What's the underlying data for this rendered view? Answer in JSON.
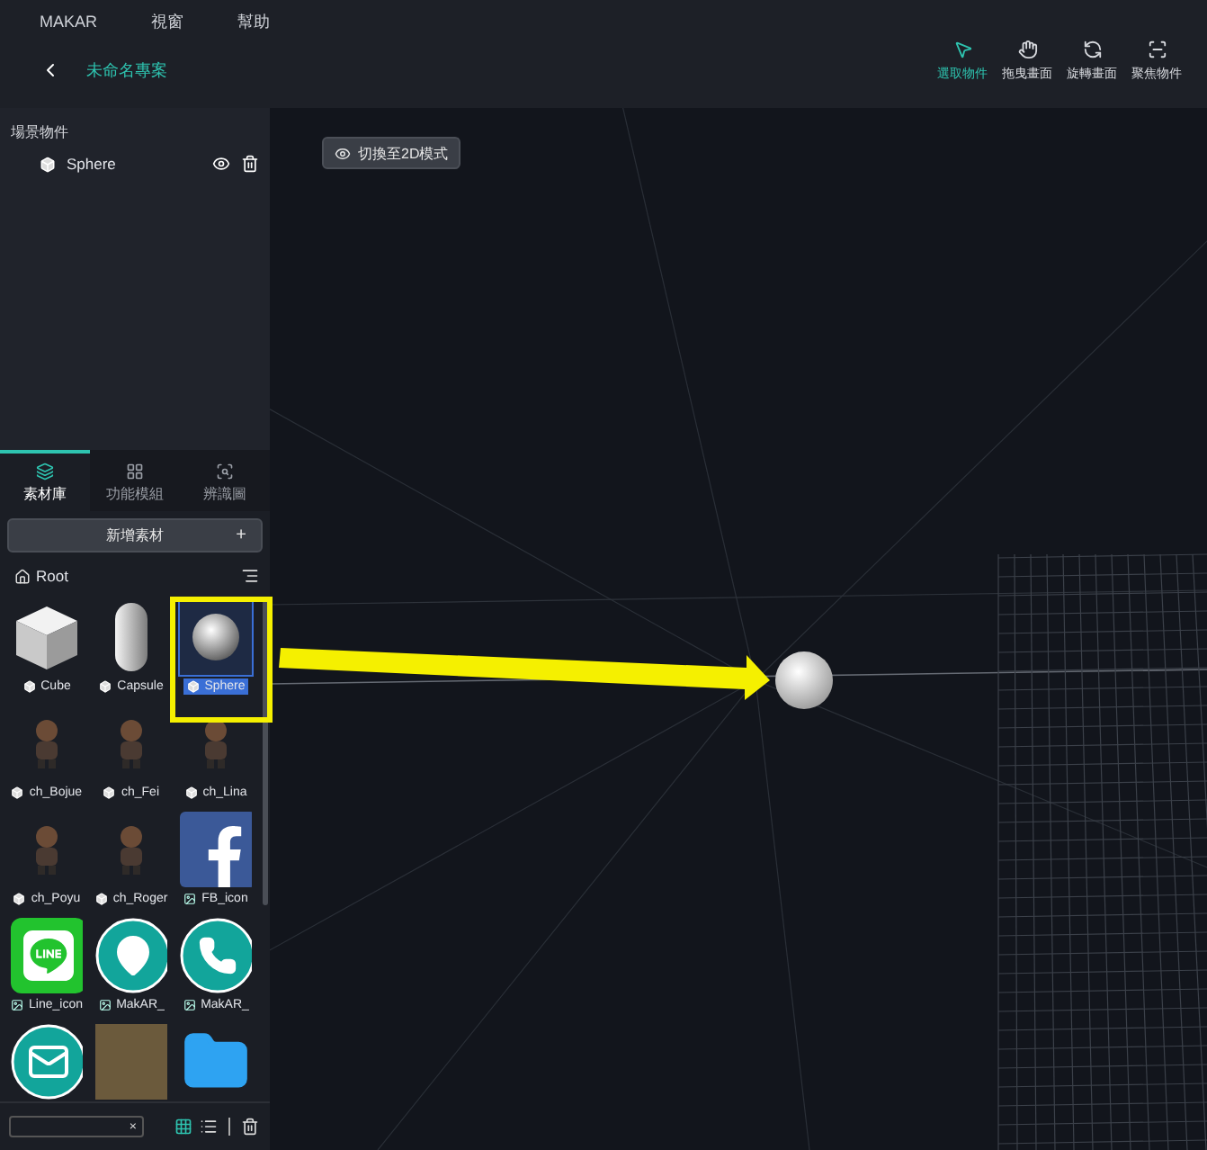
{
  "menu": [
    "MAKAR",
    "視窗",
    "幫助"
  ],
  "project_title": "未命名專案",
  "tools": [
    {
      "kind": "select",
      "label": "選取物件",
      "selected": true
    },
    {
      "kind": "pan",
      "label": "拖曳畫面",
      "selected": false
    },
    {
      "kind": "rotate",
      "label": "旋轉畫面",
      "selected": false
    },
    {
      "kind": "focus",
      "label": "聚焦物件",
      "selected": false
    }
  ],
  "scene_panel": {
    "title": "場景物件",
    "objects": [
      {
        "name": "Sphere",
        "visible": true
      }
    ]
  },
  "library_tabs": [
    {
      "kind": "assets",
      "label": "素材庫",
      "selected": true
    },
    {
      "kind": "modules",
      "label": "功能模組",
      "selected": false
    },
    {
      "kind": "targets",
      "label": "辨識圖",
      "selected": false
    }
  ],
  "add_button": {
    "label": "新增素材",
    "icon": "+"
  },
  "folder": "Root",
  "assets": [
    {
      "kind": "cube",
      "label": "Cube",
      "selected": false
    },
    {
      "kind": "capsule",
      "label": "Capsule",
      "selected": false
    },
    {
      "kind": "sphere",
      "label": "Sphere",
      "selected": true
    },
    {
      "kind": "character",
      "label": "ch_Bojue",
      "selected": false
    },
    {
      "kind": "character",
      "label": "ch_Fei",
      "selected": false
    },
    {
      "kind": "character",
      "label": "ch_Lina",
      "selected": false
    },
    {
      "kind": "character",
      "label": "ch_Poyu",
      "selected": false
    },
    {
      "kind": "character",
      "label": "ch_Roger",
      "selected": false
    },
    {
      "kind": "facebook",
      "label": "FB_icon",
      "selected": false
    },
    {
      "kind": "line",
      "label": "Line_icon",
      "selected": false
    },
    {
      "kind": "pin",
      "label": "MakAR_",
      "selected": false
    },
    {
      "kind": "phone",
      "label": "MakAR_",
      "selected": false
    },
    {
      "kind": "mail",
      "selected": false
    },
    {
      "kind": "photo",
      "selected": false
    },
    {
      "kind": "folder",
      "selected": false
    }
  ],
  "view_toggle": "切換至2D模式",
  "bottom_bar": {
    "clear": "×",
    "grid_view": true
  }
}
